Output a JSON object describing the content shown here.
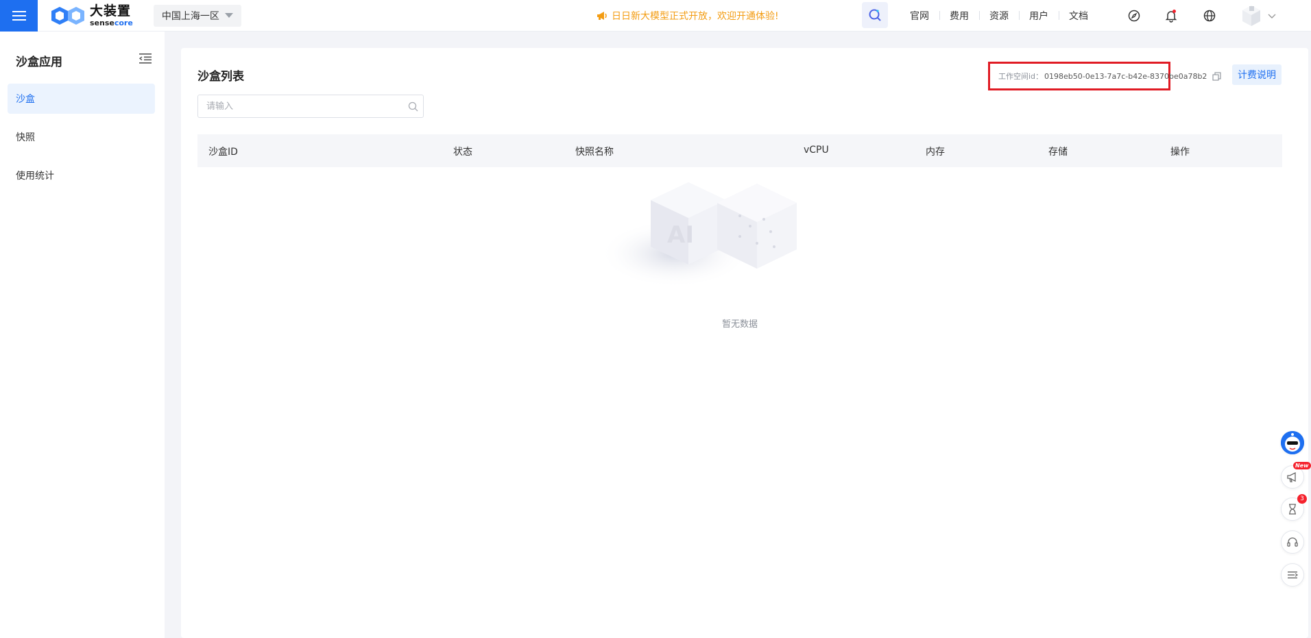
{
  "header": {
    "logo_main": "大装置",
    "logo_sub_a": "sense",
    "logo_sub_b": "core",
    "region": "中国上海一区",
    "announcement": "日日新大模型正式开放，欢迎开通体验!",
    "nav": [
      "官网",
      "费用",
      "资源",
      "用户",
      "文档"
    ],
    "icons": [
      "compass-icon",
      "bell-icon",
      "globe-icon"
    ],
    "accent": "#1e6ff0"
  },
  "sidebar": {
    "title": "沙盒应用",
    "items": [
      {
        "label": "沙盒",
        "active": true
      },
      {
        "label": "快照",
        "active": false
      },
      {
        "label": "使用统计",
        "active": false
      }
    ]
  },
  "main": {
    "title": "沙盒列表",
    "search_placeholder": "请输入",
    "workspace_label": "工作空间id：",
    "workspace_id": "0198eb50-0e13-7a7c-b42e-8370be0a78b2",
    "billing_button": "计费说明",
    "columns": [
      "沙盒ID",
      "状态",
      "快照名称",
      "vCPU",
      "内存",
      "存储",
      "操作"
    ],
    "empty_text": "暂无数据",
    "empty_illustration_text": "AI"
  },
  "float_widgets": {
    "new_badge": "New",
    "task_count": "3"
  }
}
